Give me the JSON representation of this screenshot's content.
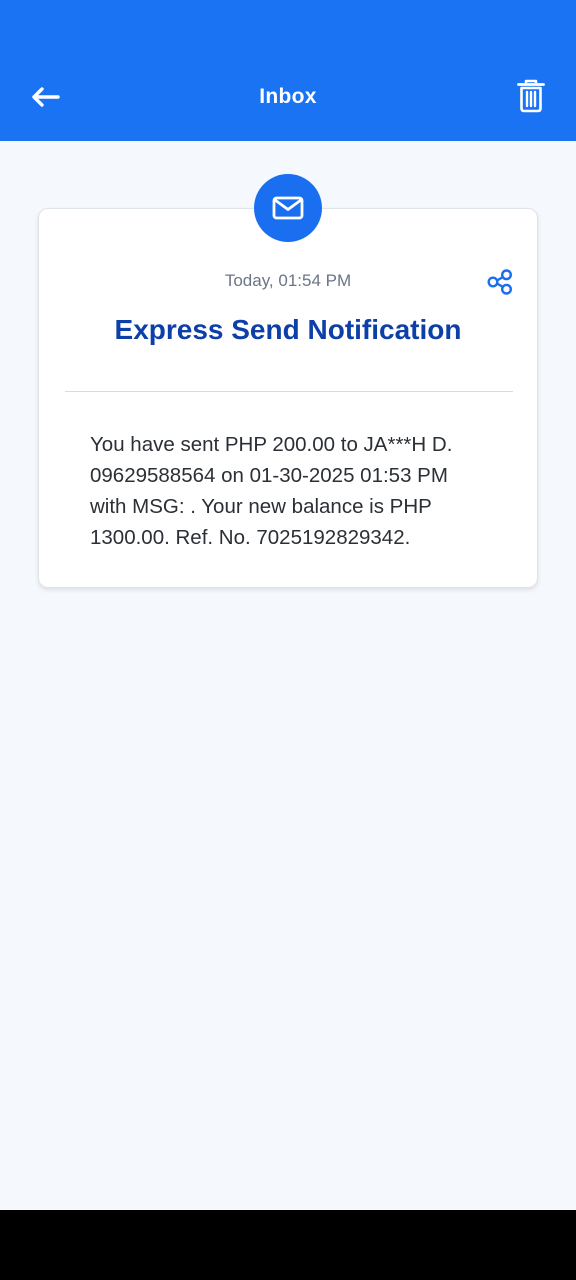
{
  "header": {
    "title": "Inbox",
    "back_icon": "arrow-left-icon",
    "delete_icon": "trash-icon"
  },
  "notification": {
    "icon": "mail-icon",
    "share_icon": "share-icon",
    "timestamp": "Today, 01:54 PM",
    "title": "Express Send Notification",
    "message": "You have sent PHP 200.00 to JA***H D. 09629588564 on 01-30-2025 01:53 PM with MSG: . Your new balance is PHP 1300.00. Ref. No. 7025192829342."
  },
  "colors": {
    "header_bg": "#1a73f2",
    "title_blue": "#0d3fa8",
    "badge_blue": "#1a6ff0",
    "share_blue": "#1a6ff0",
    "page_bg": "#f5f8fc"
  }
}
